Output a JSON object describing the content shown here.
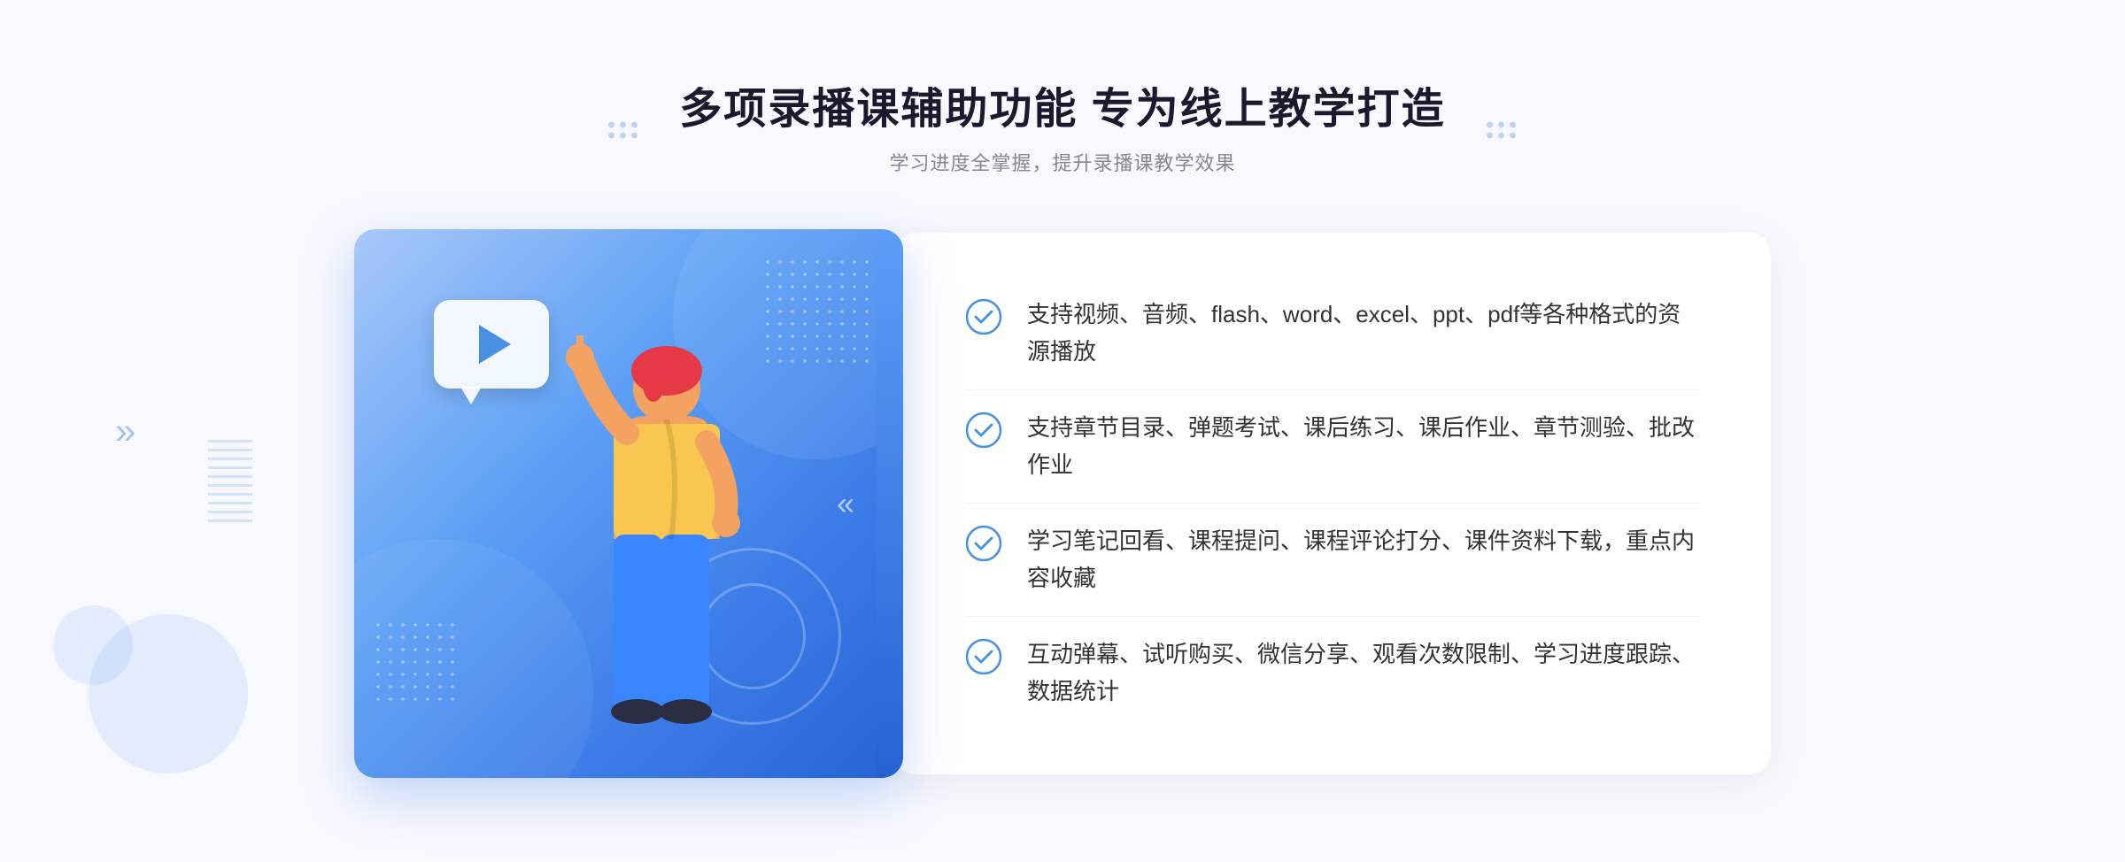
{
  "page": {
    "background": "#f8f9ff"
  },
  "header": {
    "main_title": "多项录播课辅助功能 专为线上教学打造",
    "sub_title": "学习进度全掌握，提升录播课教学效果"
  },
  "features": [
    {
      "id": 1,
      "text": "支持视频、音频、flash、word、excel、ppt、pdf等各种格式的资源播放"
    },
    {
      "id": 2,
      "text": "支持章节目录、弹题考试、课后练习、课后作业、章节测验、批改作业"
    },
    {
      "id": 3,
      "text": "学习笔记回看、课程提问、课程评论打分、课件资料下载，重点内容收藏"
    },
    {
      "id": 4,
      "text": "互动弹幕、试听购买、微信分享、观看次数限制、学习进度跟踪、数据统计"
    }
  ],
  "icons": {
    "check": "check-circle",
    "play": "play-triangle",
    "chevron": "double-chevron"
  },
  "colors": {
    "primary": "#4a90e2",
    "gradient_start": "#a8c8f8",
    "gradient_end": "#2563d4",
    "text_dark": "#1a1a2e",
    "text_medium": "#333333",
    "text_light": "#888888",
    "accent": "#3d7de8"
  }
}
